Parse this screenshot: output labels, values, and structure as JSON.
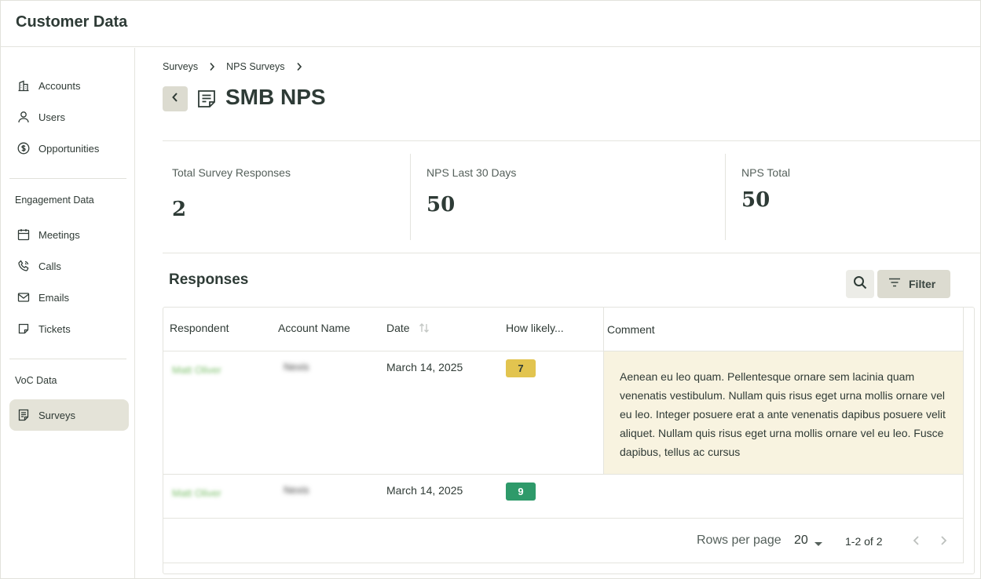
{
  "app": {
    "title": "Customer Data"
  },
  "sidebar": {
    "items": [
      {
        "label": "Accounts",
        "icon": "building-icon"
      },
      {
        "label": "Users",
        "icon": "user-icon"
      },
      {
        "label": "Opportunities",
        "icon": "dollar-circle-icon"
      }
    ],
    "engagement_label": "Engagement Data",
    "engagement_items": [
      {
        "label": "Meetings",
        "icon": "calendar-icon"
      },
      {
        "label": "Calls",
        "icon": "phone-icon"
      },
      {
        "label": "Emails",
        "icon": "mail-icon"
      },
      {
        "label": "Tickets",
        "icon": "ticket-icon"
      }
    ],
    "voc_label": "VoC Data",
    "voc_items": [
      {
        "label": "Surveys",
        "icon": "survey-icon",
        "active": true
      }
    ]
  },
  "breadcrumb": [
    "Surveys",
    "NPS Surveys"
  ],
  "page": {
    "title": "SMB NPS"
  },
  "stats": [
    {
      "label": "Total Survey Responses",
      "value": "2"
    },
    {
      "label": "NPS Last 30 Days",
      "value": "50"
    },
    {
      "label": "NPS Total",
      "value": "50"
    }
  ],
  "responses": {
    "title": "Responses",
    "filter_label": "Filter",
    "columns": [
      "Respondent",
      "Account Name",
      "Date",
      "How likely...",
      "Comment"
    ],
    "rows": [
      {
        "respondent": "Matt Oliver",
        "account": "Nexis",
        "date": "March 14, 2025",
        "score": "7",
        "score_color": "#e2c44f",
        "comment": "Aenean eu leo quam. Pellentesque ornare sem lacinia quam venenatis vestibulum. Nullam quis risus eget urna mollis ornare vel eu leo. Integer posuere erat a ante venenatis dapibus posuere velit aliquet. Nullam quis risus eget urna mollis ornare vel eu leo. Fusce dapibus, tellus ac cursus"
      },
      {
        "respondent": "Matt Oliver",
        "account": "Nexis",
        "date": "March 14, 2025",
        "score": "9",
        "score_color": "#2e9a6a",
        "comment": ""
      }
    ],
    "footer": {
      "rows_per_page_label": "Rows per page",
      "rows_per_page": "20",
      "range": "1-2 of 2"
    }
  }
}
